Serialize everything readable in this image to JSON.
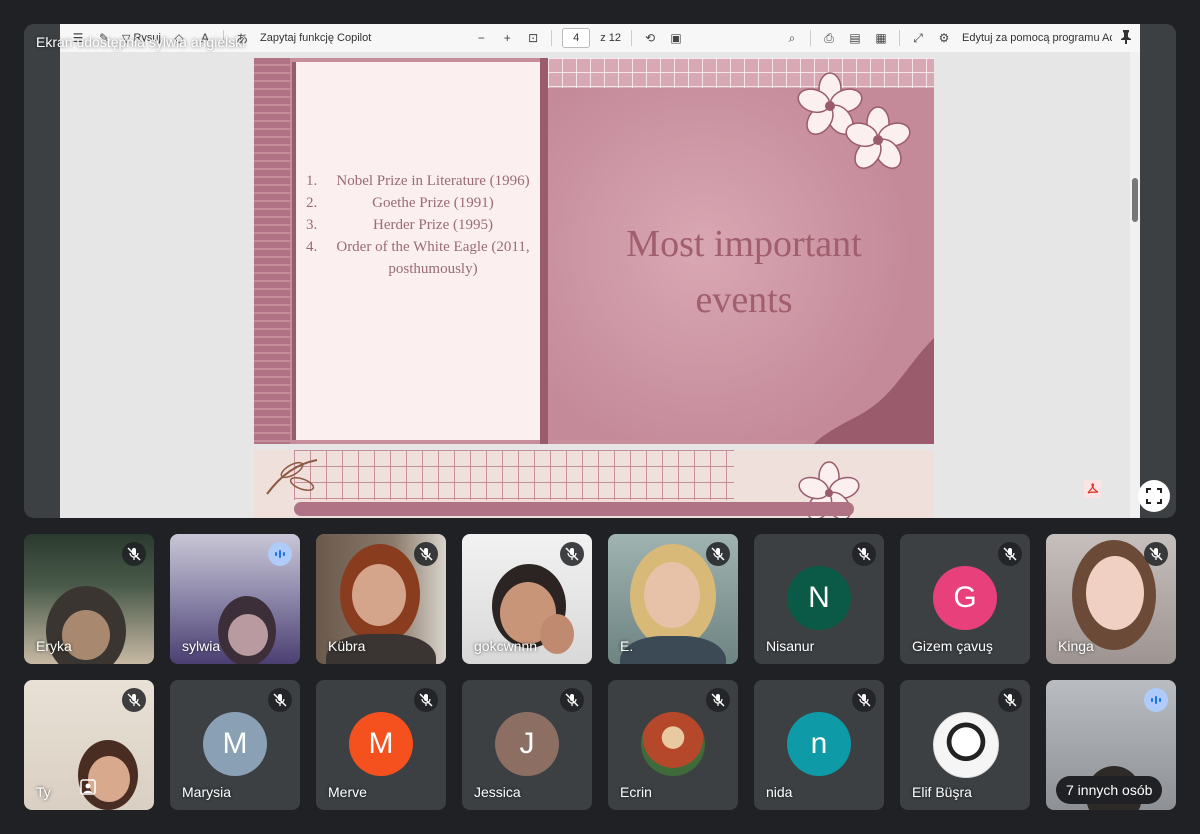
{
  "share": {
    "label": "Ekran udostępnia sylwia angielski"
  },
  "pdf_toolbar": {
    "draw_label": "Rysuj",
    "copilot_label": "Zapytaj funkcję Copilot",
    "page_current": "4",
    "page_total": "z 12",
    "edit_label": "Edytuj za pomocą programu Acrobat"
  },
  "slide": {
    "events": [
      {
        "num": "1.",
        "text": "Nobel Prize in Literature (1996)"
      },
      {
        "num": "2.",
        "text": "Goethe Prize (1991)"
      },
      {
        "num": "3.",
        "text": "Herder Prize (1995)"
      },
      {
        "num": "4.",
        "text": "Order of the White Eagle (2011, posthumously)"
      }
    ],
    "title_line1": "Most important",
    "title_line2": "events"
  },
  "participants": [
    {
      "name": "Eryka",
      "type": "video",
      "mic": "muted"
    },
    {
      "name": "sylwia",
      "type": "video",
      "mic": "speaking"
    },
    {
      "name": "Kübra",
      "type": "video",
      "mic": "muted"
    },
    {
      "name": "gokcwnnn",
      "type": "video",
      "mic": "muted"
    },
    {
      "name": "E.",
      "type": "video",
      "mic": "muted"
    },
    {
      "name": "Nisanur",
      "type": "avatar",
      "initial": "N",
      "color": "#0b5a47",
      "mic": "muted"
    },
    {
      "name": "Gizem çavuş",
      "type": "avatar",
      "initial": "G",
      "color": "#e8407a",
      "mic": "muted"
    },
    {
      "name": "Kinga",
      "type": "video",
      "mic": "muted"
    },
    {
      "name": "Ty",
      "type": "video",
      "mic": "muted"
    },
    {
      "name": "Marysia",
      "type": "avatar",
      "initial": "M",
      "color": "#8aa0b4",
      "mic": "muted"
    },
    {
      "name": "Merve",
      "type": "avatar",
      "initial": "M",
      "color": "#f4511e",
      "mic": "muted"
    },
    {
      "name": "Jessica",
      "type": "avatar",
      "initial": "J",
      "color": "#8d6e63",
      "mic": "muted"
    },
    {
      "name": "Ecrin",
      "type": "image-avatar",
      "mic": "muted"
    },
    {
      "name": "nida",
      "type": "avatar",
      "initial": "n",
      "color": "#0e9aa7",
      "mic": "muted"
    },
    {
      "name": "Elif Büşra",
      "type": "image-avatar",
      "mic": "muted"
    },
    {
      "name": "7 innych osób",
      "type": "others",
      "mic": "speaking"
    }
  ]
}
